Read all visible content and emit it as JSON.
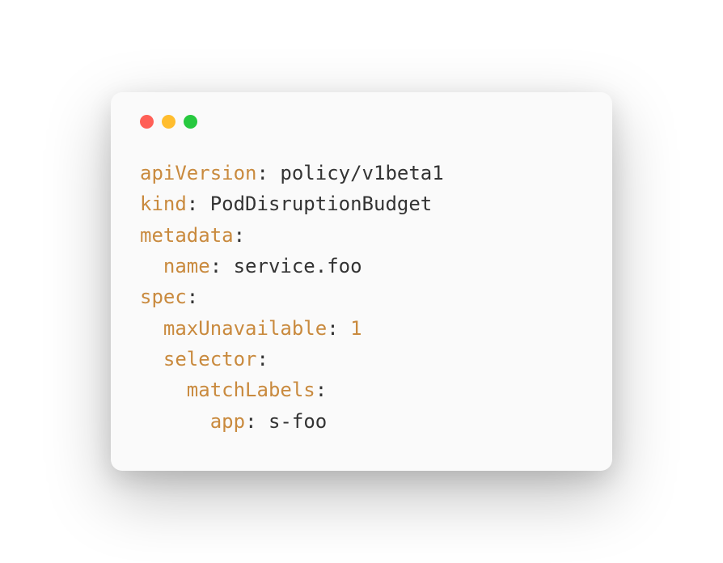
{
  "code": {
    "lines": [
      {
        "indent": 0,
        "key": "apiVersion",
        "value": "policy/v1beta1",
        "valueType": "string"
      },
      {
        "indent": 0,
        "key": "kind",
        "value": "PodDisruptionBudget",
        "valueType": "string"
      },
      {
        "indent": 0,
        "key": "metadata",
        "value": "",
        "valueType": "none"
      },
      {
        "indent": 1,
        "key": "name",
        "value": "service.foo",
        "valueType": "string"
      },
      {
        "indent": 0,
        "key": "spec",
        "value": "",
        "valueType": "none"
      },
      {
        "indent": 1,
        "key": "maxUnavailable",
        "value": "1",
        "valueType": "number"
      },
      {
        "indent": 1,
        "key": "selector",
        "value": "",
        "valueType": "none"
      },
      {
        "indent": 2,
        "key": "matchLabels",
        "value": "",
        "valueType": "none"
      },
      {
        "indent": 3,
        "key": "app",
        "value": "s-foo",
        "valueType": "string"
      }
    ]
  }
}
